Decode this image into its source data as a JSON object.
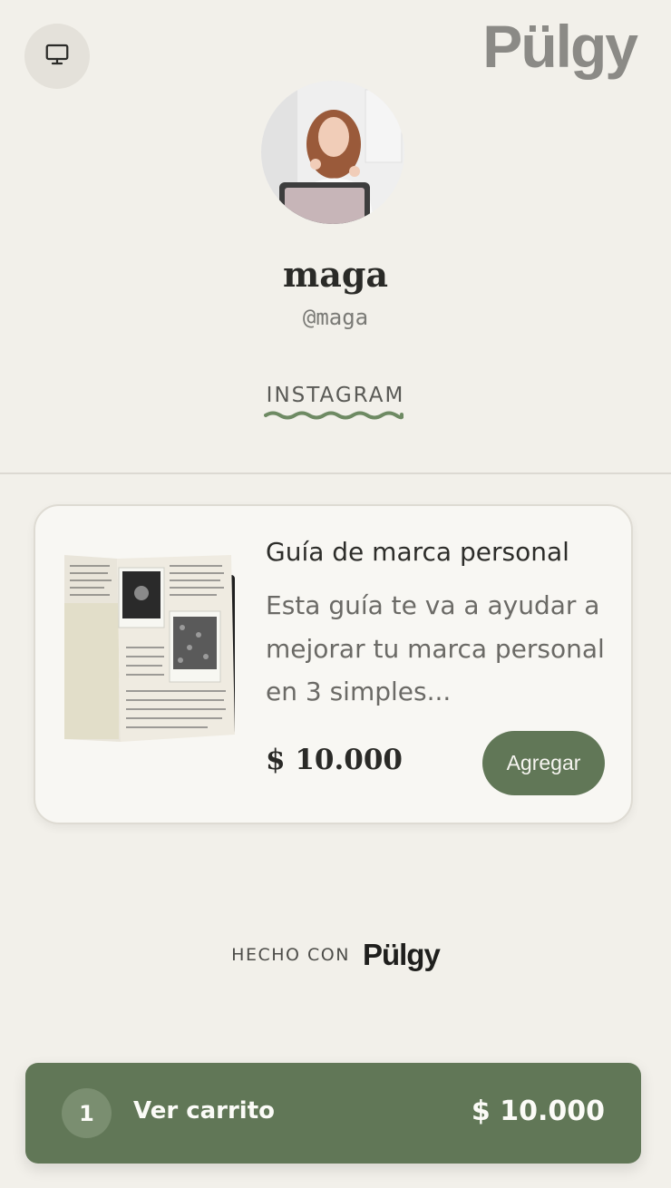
{
  "header": {
    "desktop_icon": "desktop-monitor-icon",
    "brand": "Pülgy"
  },
  "profile": {
    "name": "maga",
    "handle": "@maga",
    "social_link": "INSTAGRAM"
  },
  "product": {
    "title": "Guía de marca personal",
    "description": "Esta guía te va a ayudar a mejorar tu marca personal en 3 simples...",
    "price": "$ 10.000",
    "add_label": "Agregar"
  },
  "footer": {
    "made_with": "HECHO CON",
    "brand": "Pülgy"
  },
  "cart": {
    "count": "1",
    "label": "Ver carrito",
    "total": "$ 10.000"
  },
  "colors": {
    "background": "#f2f0ea",
    "accent": "#617757",
    "card": "#f8f7f3"
  }
}
